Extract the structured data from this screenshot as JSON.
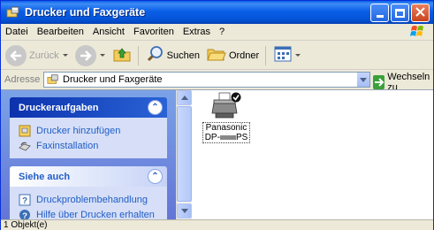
{
  "window": {
    "title": "Drucker und Faxgeräte"
  },
  "menubar": {
    "items": [
      {
        "label": "Datei"
      },
      {
        "label": "Bearbeiten"
      },
      {
        "label": "Ansicht"
      },
      {
        "label": "Favoriten"
      },
      {
        "label": "Extras"
      },
      {
        "label": "?"
      }
    ]
  },
  "toolbar": {
    "back_label": "Zurück",
    "search_label": "Suchen",
    "folders_label": "Ordner"
  },
  "address": {
    "label": "Adresse",
    "value": "Drucker und Faxgeräte",
    "go_label": "Wechseln zu"
  },
  "taskpane": {
    "printer_tasks": {
      "title": "Druckeraufgaben",
      "links": [
        {
          "label": "Drucker hinzufügen",
          "icon": "add-printer-icon"
        },
        {
          "label": "Faxinstallation",
          "icon": "fax-icon"
        }
      ]
    },
    "see_also": {
      "title": "Siehe auch",
      "links": [
        {
          "label": "Druckproblembehandlung",
          "icon": "help-icon"
        },
        {
          "label": "Hilfe über Drucken erhalten",
          "icon": "help-icon"
        }
      ]
    }
  },
  "content": {
    "printer": {
      "line1": "Panasonic",
      "line2_prefix": "DP-",
      "line2_suffix": "PS",
      "is_default": true
    }
  },
  "statusbar": {
    "text": "1 Objekt(e)"
  },
  "colors": {
    "titlebar": "#0a5fe8",
    "taskpane_bg": "#6f8ddc",
    "link": "#215dc6"
  }
}
